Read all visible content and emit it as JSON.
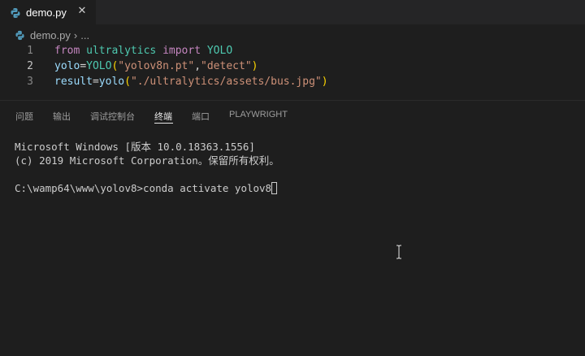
{
  "editor_tab": {
    "title": "demo.py",
    "icon": "python-file-icon",
    "close_glyph": "✕"
  },
  "breadcrumb": {
    "file": "demo.py",
    "separator": "›",
    "more": "..."
  },
  "code_lines": [
    {
      "number": "1",
      "tokens": {
        "t1": "from",
        "t2": " ",
        "t3": "ultralytics",
        "t4": " ",
        "t5": "import",
        "t6": " ",
        "t7": "YOLO"
      }
    },
    {
      "number": "2",
      "tokens": {
        "t1": "yolo",
        "t2": "=",
        "t3": "YOLO",
        "t4": "(",
        "t5": "\"yolov8n.pt\"",
        "t6": ",",
        "t7": "\"detect\"",
        "t8": ")"
      }
    },
    {
      "number": "3",
      "tokens": {
        "t1": "result",
        "t2": "=",
        "t3": "yolo",
        "t4": "(",
        "t5": "\"./ultralytics/assets/bus.jpg\"",
        "t6": ")"
      }
    }
  ],
  "active_line": 2,
  "panel_tabs": {
    "problems": "问题",
    "output": "输出",
    "debug_console": "调试控制台",
    "terminal": "终端",
    "ports": "端口",
    "playwright": "PLAYWRIGHT"
  },
  "active_panel_tab": "终端",
  "terminal": {
    "line1": "Microsoft Windows [版本 10.0.18363.1556]",
    "line2": "(c) 2019 Microsoft Corporation。保留所有权利。",
    "prompt": "C:\\wamp64\\www\\yolov8>",
    "command": "conda activate yolov8"
  },
  "colors": {
    "background": "#1e1e1e",
    "tabbar": "#252526",
    "keyword": "#c586c0",
    "class": "#4ec9b0",
    "variable": "#9cdcfe",
    "string": "#ce9178",
    "bracket": "#ffd700",
    "python_icon_blue": "#519aba"
  }
}
